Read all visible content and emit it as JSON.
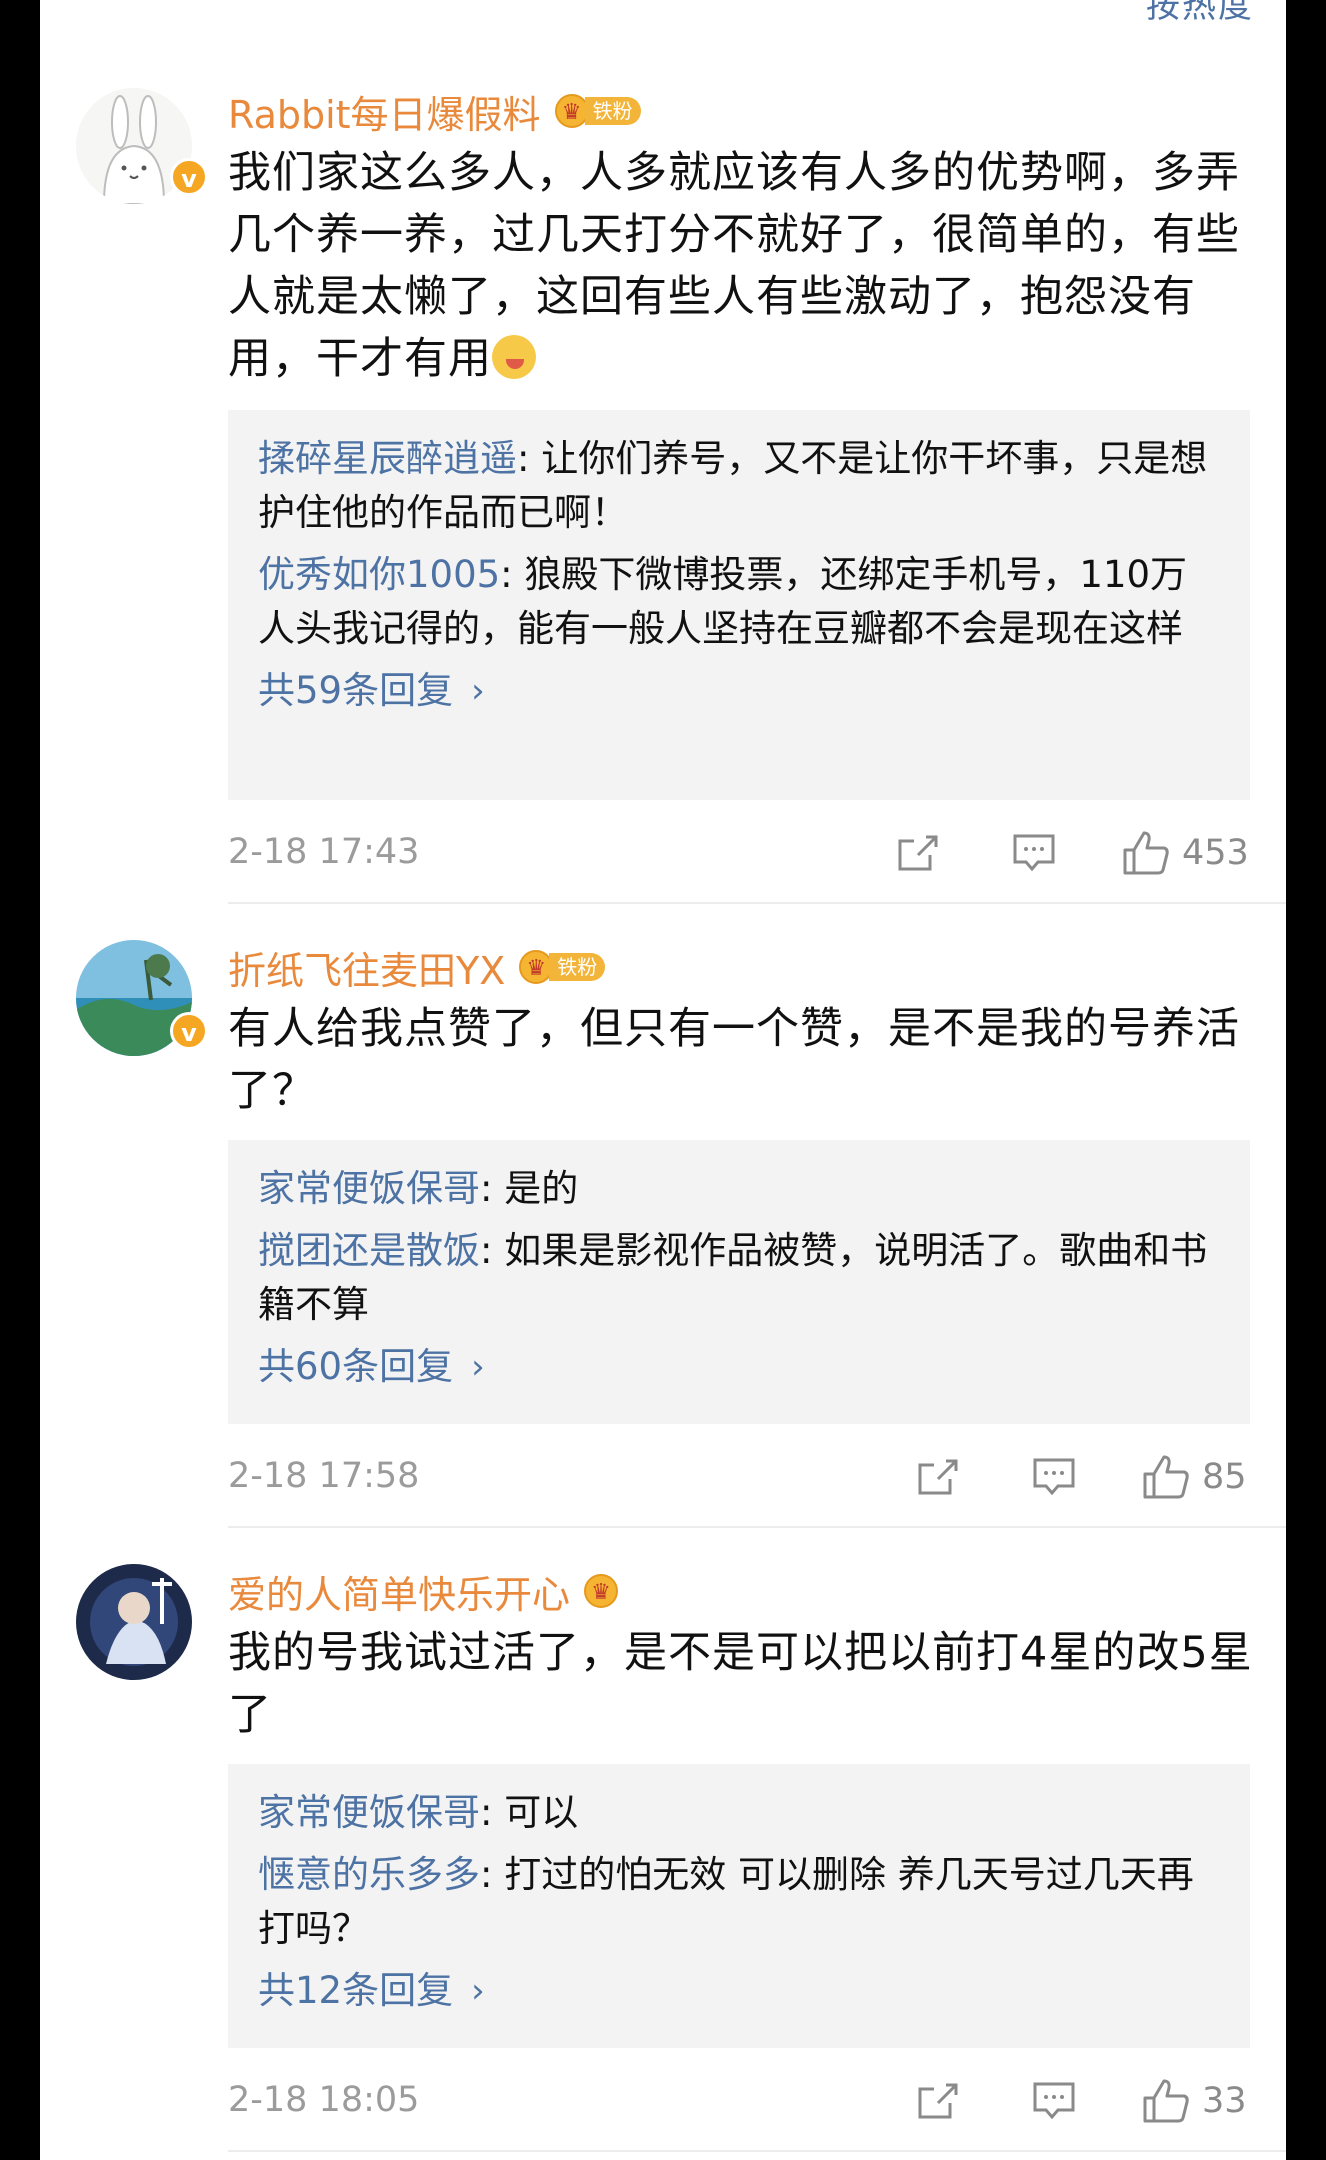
{
  "header": {
    "sort_label": "按热度"
  },
  "comments": [
    {
      "username": "Rabbit每日爆假料",
      "fan_badge": "铁粉",
      "verified": true,
      "text": "我们家这么多人，人多就应该有人多的优势啊，多弄几个养一养，过几天打分不就好了，很简单的，有些人就是太懒了，这回有些人有些激动了，抱怨没有用，干才有用",
      "emoji": "tongue-face-emoji",
      "replies": [
        {
          "name": "揉碎星辰醉逍遥",
          "sep": ": ",
          "text": "让你们养号，又不是让你干坏事，只是想护住他的作品而已啊！"
        },
        {
          "name": "优秀如你1005",
          "sep": ": ",
          "text": "狼殿下微博投票，还绑定手机号，110万人头我记得的，能有一般人坚持在豆瓣都不会是现在这样"
        }
      ],
      "more_replies": "共59条回复",
      "time": "2-18 17:43",
      "likes": "453"
    },
    {
      "username": "折纸飞往麦田YX",
      "fan_badge": "铁粉",
      "verified": true,
      "text": "有人给我点赞了，但只有一个赞，是不是我的号养活了？",
      "replies": [
        {
          "name": "家常便饭保哥",
          "sep": ": ",
          "text": "是的"
        },
        {
          "name": "搅团还是散饭",
          "sep": ": ",
          "text": "如果是影视作品被赞，说明活了。歌曲和书籍不算"
        }
      ],
      "more_replies": "共60条回复",
      "time": "2-18 17:58",
      "likes": "85"
    },
    {
      "username": "爱的人简单快乐开心",
      "fan_badge": "",
      "verified": false,
      "text": "我的号我试过活了，是不是可以把以前打4星的改5星了",
      "replies": [
        {
          "name": "家常便饭保哥",
          "sep": ": ",
          "text": "可以"
        },
        {
          "name": "惬意的乐多多",
          "sep": ": ",
          "text": "打过的怕无效 可以删除 养几天号过几天再打吗？"
        }
      ],
      "more_replies": "共12条回复",
      "time": "2-18 18:05",
      "likes": "33"
    }
  ],
  "colors": {
    "username": "#e8893c",
    "link": "#4d72a4",
    "meta": "#9b9b9b",
    "reply_bg": "#f3f3f3"
  }
}
